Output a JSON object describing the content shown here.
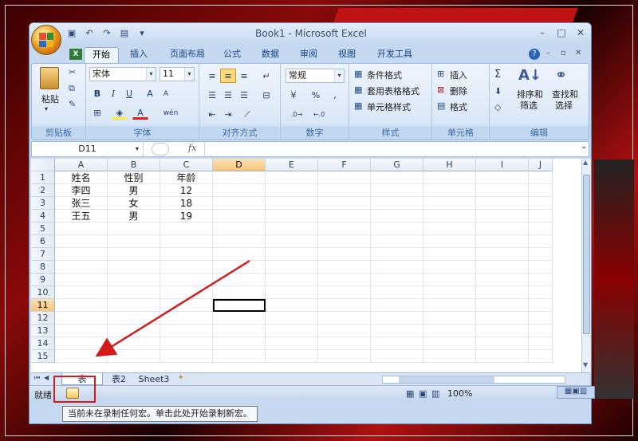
{
  "app": {
    "title": "Book1 - Microsoft Excel"
  },
  "quick_access": {
    "save_icon": "save-icon",
    "undo_icon": "undo-icon",
    "redo_icon": "redo-icon",
    "customize_icon": "customize-icon",
    "more": "▾"
  },
  "tabs": [
    "开始",
    "插入",
    "页面布局",
    "公式",
    "数据",
    "审阅",
    "视图",
    "开发工具"
  ],
  "ribbon": {
    "clipboard": {
      "paste": "粘贴",
      "label": "剪贴板"
    },
    "font": {
      "name": "宋体",
      "size": "11",
      "label": "字体",
      "bold": "B",
      "italic": "I",
      "underline": "U",
      "grow": "A",
      "wen": "wén"
    },
    "align": {
      "label": "对齐方式"
    },
    "number": {
      "format": "常规",
      "percent": "%",
      "comma": ",",
      "label": "数字"
    },
    "styles": {
      "cond": "条件格式",
      "table": "套用表格格式",
      "cell": "单元格样式",
      "label": "样式"
    },
    "cells": {
      "insert": "插入",
      "delete": "删除",
      "format": "格式",
      "label": "单元格"
    },
    "editing": {
      "sigma": "Σ",
      "sort1": "排序和",
      "sort2": "筛选",
      "find1": "查找和",
      "find2": "选择",
      "label": "编辑"
    }
  },
  "formula_bar": {
    "name_box": "D11",
    "fx": "fx",
    "value": ""
  },
  "columns": [
    "A",
    "B",
    "C",
    "D",
    "E",
    "F",
    "G",
    "H",
    "I",
    "J"
  ],
  "rows": [
    "1",
    "2",
    "3",
    "4",
    "5",
    "6",
    "7",
    "8",
    "9",
    "10",
    "11",
    "12",
    "13",
    "14",
    "15"
  ],
  "cells": [
    [
      "姓名",
      "性别",
      "年龄"
    ],
    [
      "李四",
      "男",
      "12"
    ],
    [
      "张三",
      "女",
      "18"
    ],
    [
      "王五",
      "男",
      "19"
    ]
  ],
  "selected": {
    "col": "D",
    "row": "11"
  },
  "sheets": [
    "表",
    "表2",
    "Sheet3"
  ],
  "status": {
    "ready": "就绪",
    "zoom": "100%"
  },
  "tooltip": "当前未在录制任何宏。单击此处开始录制新宏。",
  "colors": {
    "annotation": "#d41a1a",
    "ribbon": "#dde9f8",
    "selection": "#f8c479"
  }
}
